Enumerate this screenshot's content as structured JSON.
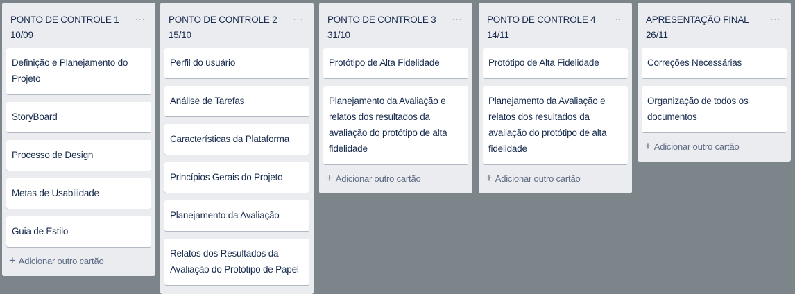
{
  "board": {
    "lists": [
      {
        "title": "PONTO DE CONTROLE 1 10/09",
        "more_label": "···",
        "cards": [
          "Definição e Planejamento do Projeto",
          "StoryBoard",
          "Processo de Design",
          "Metas de Usabilidade",
          "Guia de Estilo"
        ],
        "add_label": "Adicionar outro cartão"
      },
      {
        "title": "PONTO DE CONTROLE 2 15/10",
        "more_label": "···",
        "cards": [
          "Perfil do usuário",
          "Análise de Tarefas",
          "Características da Plataforma",
          "Princípios Gerais do Projeto",
          "Planejamento da Avaliação",
          "Relatos dos Resultados da Avaliação do Protótipo de Papel"
        ],
        "add_label": ""
      },
      {
        "title": "PONTO DE CONTROLE 3 31/10",
        "more_label": "···",
        "cards": [
          "Protótipo de Alta Fidelidade",
          "Planejamento da Avaliação e relatos dos resultados da avaliação do protótipo de alta fidelidade"
        ],
        "add_label": "Adicionar outro cartão"
      },
      {
        "title": "PONTO DE CONTROLE 4\n14/11",
        "more_label": "···",
        "cards": [
          "Protótipo de Alta Fidelidade",
          "Planejamento da Avaliação e relatos dos resultados da avaliação do protótipo de alta fidelidade"
        ],
        "add_label": "Adicionar outro cartão"
      },
      {
        "title": "APRESENTAÇÃO FINAL\n26/11",
        "more_label": "···",
        "cards": [
          "Correções Necessárias",
          "Organização de todos os documentos"
        ],
        "add_label": "Adicionar outro cartão"
      }
    ],
    "add_icon": "plus-icon",
    "more_icon": "ellipsis-icon"
  },
  "colors": {
    "board_background": "#7c858a",
    "list_background": "#ebecf0",
    "card_background": "#ffffff",
    "card_text": "#172b4d",
    "muted_text": "#5e6c84"
  }
}
